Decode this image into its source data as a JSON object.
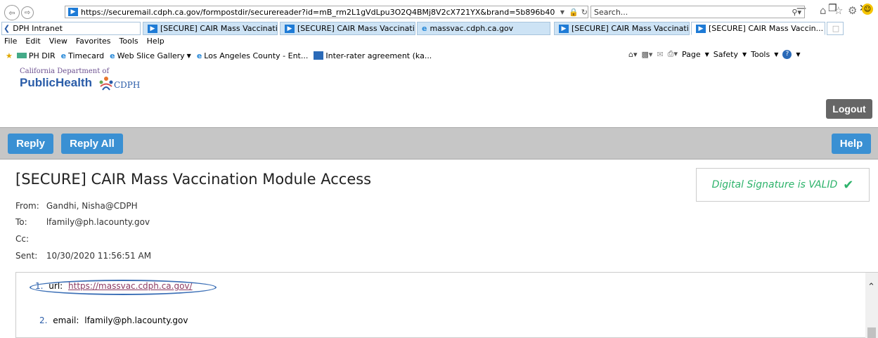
{
  "browser": {
    "url": "https://securemail.cdph.ca.gov/formpostdir/securereader?id=mB_rm2L1gVdLpu3O2Q4BMj8V2cX721YX&brand=5b896b40",
    "search_placeholder": "Search...",
    "tabs": [
      {
        "label": "DPH Intranet"
      },
      {
        "label": "[SECURE] CAIR Mass Vaccinati..."
      },
      {
        "label": "[SECURE] CAIR Mass Vaccinati..."
      },
      {
        "label": "massvac.cdph.ca.gov"
      },
      {
        "label": "[SECURE] CAIR Mass Vaccinati..."
      },
      {
        "label": "[SECURE] CAIR Mass Vaccin..."
      }
    ],
    "menu": [
      "File",
      "Edit",
      "View",
      "Favorites",
      "Tools",
      "Help"
    ],
    "favorites": [
      "PH DIR",
      "Timecard",
      "Web Slice Gallery",
      "Los Angeles County - Ent...",
      "Inter-rater agreement (ka..."
    ],
    "command_bar": {
      "page": "Page",
      "safety": "Safety",
      "tools": "Tools"
    }
  },
  "header": {
    "logo_line1": "California Department of",
    "logo_line2": "PublicHealth",
    "logo_mark": "CDPH",
    "logout": "Logout"
  },
  "toolbar": {
    "reply": "Reply",
    "reply_all": "Reply All",
    "help": "Help"
  },
  "message": {
    "subject": "[SECURE] CAIR Mass Vaccination Module Access",
    "signature": "Digital Signature is VALID",
    "from_label": "From:",
    "from": "Gandhi, Nisha@CDPH",
    "to_label": "To:",
    "to": "lfamily@ph.lacounty.gov",
    "cc_label": "Cc:",
    "cc": "",
    "sent_label": "Sent:",
    "sent": "10/30/2020 11:56:51 AM",
    "items": [
      {
        "num": "1.",
        "key": "url:",
        "value": "https://massvac.cdph.ca.gov/"
      },
      {
        "num": "2.",
        "key": "email:",
        "value": "lfamily@ph.lacounty.gov"
      }
    ]
  },
  "colors": {
    "accent": "#3a90d3",
    "signature": "#2db36b",
    "link": "#8b3a62"
  }
}
